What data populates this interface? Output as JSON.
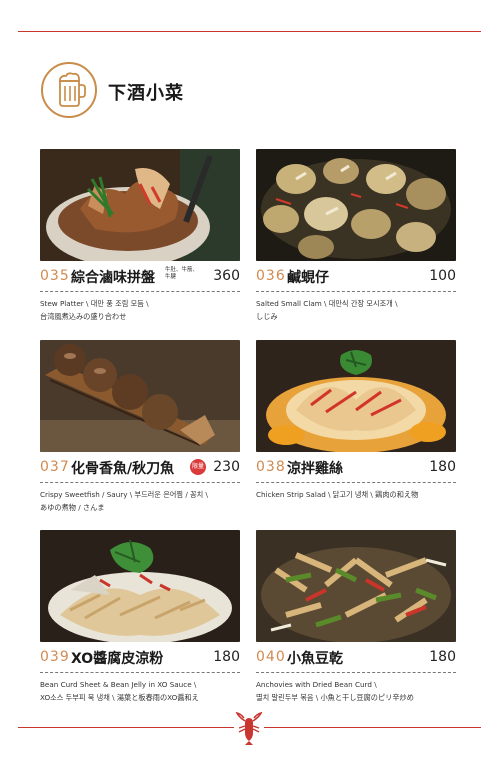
{
  "header": {
    "title": "下酒小菜",
    "icon": "beer-mug-icon",
    "accent": "#c98c4a",
    "rule_color": "#c8362f"
  },
  "dishes": [
    {
      "number": "035",
      "name": "綜合滷味拼盤",
      "note": "牛肚、牛筋、牛腱",
      "price": "360",
      "desc1": "Stew Platter \\ 대만 풍 조림 모듬 \\",
      "desc2": "台湾風煮込みの盛り合わせ"
    },
    {
      "number": "036",
      "name": "鹹蜆仔",
      "price": "100",
      "desc1": "Salted Small Clam \\ 대만식 간장 모시조개 \\",
      "desc2": "しじみ"
    },
    {
      "number": "037",
      "name": "化骨香魚/秋刀魚",
      "badge": "限量",
      "price": "230",
      "desc1": "Crispy Sweetfish / Saury \\ 부드러운 은어찜 / 꽁치 \\",
      "desc2": "あゆの煮物 / さんま"
    },
    {
      "number": "038",
      "name": "涼拌雞絲",
      "price": "180",
      "desc1": "Chicken Strip Salad \\ 닭고기 냉채 \\ 鶏肉の和え物",
      "desc2": ""
    },
    {
      "number": "039",
      "name": "XO醬腐皮涼粉",
      "price": "180",
      "desc1": "Bean Curd Sheet & Bean Jelly in XO Sauce \\",
      "desc2": "XO소스 두부피 묵 냉채 \\ 湯葉と板春雨のXO醤和え"
    },
    {
      "number": "040",
      "name": "小魚豆乾",
      "price": "180",
      "desc1": "Anchovies with Dried Bean Curd \\",
      "desc2": "멸치 말린두부 볶음 \\ 小魚と干し豆腐のピリ辛炒め"
    }
  ],
  "footer": {
    "icon": "lobster-icon"
  }
}
